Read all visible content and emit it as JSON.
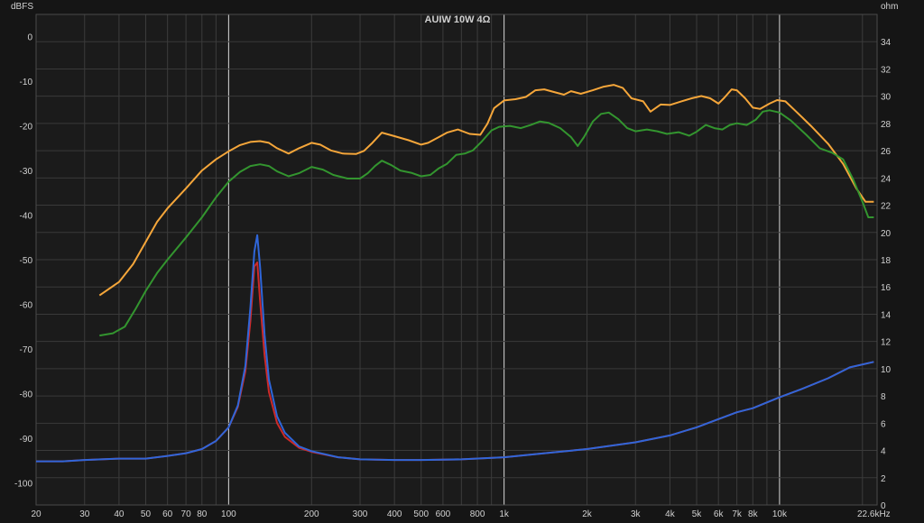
{
  "chart_data": {
    "type": "line",
    "title": "AUIW 10W 4Ω",
    "ylabel": "dBFS",
    "y2label": "ohm",
    "x_scale": "log",
    "xlim": [
      20,
      22600
    ],
    "ylim": [
      -105,
      5
    ],
    "y2lim": [
      0,
      36
    ],
    "grid": true,
    "x_ticks": [
      {
        "v": 20,
        "t": "20"
      },
      {
        "v": 30,
        "t": "30"
      },
      {
        "v": 40,
        "t": "40"
      },
      {
        "v": 50,
        "t": "50"
      },
      {
        "v": 60,
        "t": "60"
      },
      {
        "v": 70,
        "t": "70"
      },
      {
        "v": 80,
        "t": "80"
      },
      {
        "v": 100,
        "t": "100"
      },
      {
        "v": 200,
        "t": "200"
      },
      {
        "v": 300,
        "t": "300"
      },
      {
        "v": 400,
        "t": "400"
      },
      {
        "v": 500,
        "t": "500"
      },
      {
        "v": 600,
        "t": "600"
      },
      {
        "v": 800,
        "t": "800"
      },
      {
        "v": 1000,
        "t": "1k"
      },
      {
        "v": 2000,
        "t": "2k"
      },
      {
        "v": 3000,
        "t": "3k"
      },
      {
        "v": 4000,
        "t": "4k"
      },
      {
        "v": 5000,
        "t": "5k"
      },
      {
        "v": 6000,
        "t": "6k"
      },
      {
        "v": 7000,
        "t": "7k"
      },
      {
        "v": 8000,
        "t": "8k"
      },
      {
        "v": 10000,
        "t": "10k"
      },
      {
        "v": 22600,
        "t": "22.6kHz"
      }
    ],
    "y_ticks": [
      "0",
      "-10",
      "-20",
      "-30",
      "-40",
      "-50",
      "-60",
      "-70",
      "-80",
      "-90",
      "-100"
    ],
    "y2_ticks": [
      "0",
      "2",
      "4",
      "6",
      "8",
      "10",
      "12",
      "14",
      "16",
      "18",
      "20",
      "22",
      "24",
      "26",
      "28",
      "30",
      "32",
      "34"
    ],
    "series": [
      {
        "axis": "left",
        "color": "#f5a63a",
        "points": [
          [
            34,
            -58
          ],
          [
            40,
            -55
          ],
          [
            45,
            -51
          ],
          [
            50,
            -46
          ],
          [
            55,
            -41.5
          ],
          [
            60,
            -38.5
          ],
          [
            70,
            -34
          ],
          [
            80,
            -30
          ],
          [
            90,
            -27.5
          ],
          [
            100,
            -25.7
          ],
          [
            110,
            -24.3
          ],
          [
            120,
            -23.6
          ],
          [
            130,
            -23.4
          ],
          [
            140,
            -23.8
          ],
          [
            150,
            -25
          ],
          [
            165,
            -26.2
          ],
          [
            180,
            -25
          ],
          [
            200,
            -23.8
          ],
          [
            215,
            -24.2
          ],
          [
            235,
            -25.5
          ],
          [
            260,
            -26.2
          ],
          [
            290,
            -26.3
          ],
          [
            310,
            -25.6
          ],
          [
            330,
            -24
          ],
          [
            360,
            -21.5
          ],
          [
            400,
            -22.3
          ],
          [
            450,
            -23.2
          ],
          [
            500,
            -24.2
          ],
          [
            530,
            -23.8
          ],
          [
            580,
            -22.5
          ],
          [
            620,
            -21.5
          ],
          [
            680,
            -20.8
          ],
          [
            750,
            -21.8
          ],
          [
            820,
            -22
          ],
          [
            870,
            -19.5
          ],
          [
            920,
            -16
          ],
          [
            1000,
            -14.3
          ],
          [
            1100,
            -14
          ],
          [
            1200,
            -13.5
          ],
          [
            1300,
            -12
          ],
          [
            1400,
            -11.8
          ],
          [
            1500,
            -12.3
          ],
          [
            1650,
            -13
          ],
          [
            1750,
            -12.2
          ],
          [
            1900,
            -12.8
          ],
          [
            2100,
            -12
          ],
          [
            2300,
            -11.2
          ],
          [
            2500,
            -10.8
          ],
          [
            2700,
            -11.5
          ],
          [
            2900,
            -13.8
          ],
          [
            3200,
            -14.5
          ],
          [
            3400,
            -16.8
          ],
          [
            3700,
            -15.2
          ],
          [
            4000,
            -15.3
          ],
          [
            4400,
            -14.5
          ],
          [
            4800,
            -13.8
          ],
          [
            5200,
            -13.3
          ],
          [
            5600,
            -13.8
          ],
          [
            6000,
            -15
          ],
          [
            6300,
            -13.7
          ],
          [
            6700,
            -11.8
          ],
          [
            7000,
            -12
          ],
          [
            7500,
            -13.8
          ],
          [
            8000,
            -15.9
          ],
          [
            8500,
            -16.2
          ],
          [
            9200,
            -15
          ],
          [
            9800,
            -14.2
          ],
          [
            10500,
            -14.5
          ],
          [
            11500,
            -16.8
          ],
          [
            13000,
            -20
          ],
          [
            15000,
            -24
          ],
          [
            17000,
            -28.5
          ],
          [
            19000,
            -34
          ],
          [
            20500,
            -37
          ],
          [
            22000,
            -37
          ]
        ]
      },
      {
        "axis": "left",
        "color": "#33952f",
        "points": [
          [
            34,
            -67
          ],
          [
            38,
            -66.5
          ],
          [
            42,
            -65
          ],
          [
            46,
            -61
          ],
          [
            50,
            -57
          ],
          [
            55,
            -53
          ],
          [
            60,
            -50
          ],
          [
            70,
            -45
          ],
          [
            80,
            -40.5
          ],
          [
            90,
            -36
          ],
          [
            100,
            -32.5
          ],
          [
            110,
            -30.3
          ],
          [
            120,
            -29
          ],
          [
            130,
            -28.6
          ],
          [
            140,
            -29
          ],
          [
            150,
            -30.2
          ],
          [
            165,
            -31.3
          ],
          [
            180,
            -30.6
          ],
          [
            200,
            -29.2
          ],
          [
            220,
            -29.8
          ],
          [
            240,
            -31
          ],
          [
            270,
            -31.8
          ],
          [
            300,
            -31.8
          ],
          [
            320,
            -30.6
          ],
          [
            340,
            -29
          ],
          [
            360,
            -27.8
          ],
          [
            390,
            -28.8
          ],
          [
            420,
            -30
          ],
          [
            460,
            -30.5
          ],
          [
            500,
            -31.3
          ],
          [
            540,
            -31
          ],
          [
            580,
            -29.5
          ],
          [
            620,
            -28.5
          ],
          [
            670,
            -26.5
          ],
          [
            720,
            -26.2
          ],
          [
            770,
            -25.5
          ],
          [
            830,
            -23.5
          ],
          [
            900,
            -21
          ],
          [
            960,
            -20.2
          ],
          [
            1050,
            -20
          ],
          [
            1150,
            -20.5
          ],
          [
            1250,
            -19.8
          ],
          [
            1350,
            -19
          ],
          [
            1450,
            -19.3
          ],
          [
            1600,
            -20.5
          ],
          [
            1750,
            -22.5
          ],
          [
            1850,
            -24.5
          ],
          [
            1950,
            -22.5
          ],
          [
            2100,
            -19
          ],
          [
            2250,
            -17.3
          ],
          [
            2400,
            -17
          ],
          [
            2600,
            -18.5
          ],
          [
            2800,
            -20.5
          ],
          [
            3000,
            -21.2
          ],
          [
            3300,
            -20.8
          ],
          [
            3600,
            -21.2
          ],
          [
            3900,
            -21.8
          ],
          [
            4300,
            -21.4
          ],
          [
            4700,
            -22.2
          ],
          [
            5000,
            -21.3
          ],
          [
            5400,
            -19.8
          ],
          [
            5800,
            -20.5
          ],
          [
            6200,
            -20.8
          ],
          [
            6600,
            -19.8
          ],
          [
            7000,
            -19.4
          ],
          [
            7600,
            -19.8
          ],
          [
            8200,
            -18.6
          ],
          [
            8700,
            -16.8
          ],
          [
            9200,
            -16.5
          ],
          [
            10000,
            -17
          ],
          [
            11000,
            -18.8
          ],
          [
            12500,
            -22
          ],
          [
            14000,
            -25
          ],
          [
            15500,
            -26
          ],
          [
            17000,
            -27.5
          ],
          [
            18500,
            -32
          ],
          [
            20000,
            -37
          ],
          [
            21000,
            -40.5
          ],
          [
            22000,
            -40.5
          ]
        ]
      },
      {
        "axis": "right",
        "color": "#cc2a2a",
        "points": [
          [
            20,
            3.2
          ],
          [
            25,
            3.2
          ],
          [
            30,
            3.3
          ],
          [
            40,
            3.4
          ],
          [
            50,
            3.4
          ],
          [
            60,
            3.6
          ],
          [
            70,
            3.8
          ],
          [
            80,
            4.1
          ],
          [
            90,
            4.7
          ],
          [
            100,
            5.7
          ],
          [
            108,
            7.2
          ],
          [
            115,
            9.8
          ],
          [
            120,
            13.5
          ],
          [
            124,
            17.5
          ],
          [
            127,
            17.8
          ],
          [
            130,
            15
          ],
          [
            135,
            11
          ],
          [
            140,
            8.3
          ],
          [
            150,
            6
          ],
          [
            160,
            5
          ],
          [
            180,
            4.2
          ],
          [
            200,
            3.9
          ],
          [
            250,
            3.5
          ],
          [
            300,
            3.35
          ],
          [
            400,
            3.3
          ],
          [
            500,
            3.3
          ],
          [
            700,
            3.35
          ],
          [
            1000,
            3.5
          ],
          [
            1500,
            3.85
          ],
          [
            2000,
            4.1
          ],
          [
            3000,
            4.6
          ],
          [
            4000,
            5.1
          ],
          [
            5000,
            5.7
          ],
          [
            6000,
            6.3
          ],
          [
            7000,
            6.8
          ],
          [
            8000,
            7.1
          ],
          [
            10000,
            7.9
          ],
          [
            12000,
            8.5
          ],
          [
            15000,
            9.3
          ],
          [
            18000,
            10.1
          ],
          [
            22000,
            10.5
          ]
        ]
      },
      {
        "axis": "right",
        "color": "#2f66d9",
        "points": [
          [
            20,
            3.2
          ],
          [
            25,
            3.2
          ],
          [
            30,
            3.3
          ],
          [
            40,
            3.4
          ],
          [
            50,
            3.4
          ],
          [
            60,
            3.6
          ],
          [
            70,
            3.8
          ],
          [
            80,
            4.1
          ],
          [
            90,
            4.7
          ],
          [
            100,
            5.7
          ],
          [
            108,
            7.3
          ],
          [
            115,
            10.2
          ],
          [
            120,
            14.5
          ],
          [
            124,
            18.6
          ],
          [
            127,
            19.8
          ],
          [
            130,
            17.5
          ],
          [
            135,
            12.5
          ],
          [
            140,
            9.2
          ],
          [
            150,
            6.5
          ],
          [
            160,
            5.3
          ],
          [
            180,
            4.3
          ],
          [
            200,
            3.95
          ],
          [
            250,
            3.5
          ],
          [
            300,
            3.35
          ],
          [
            400,
            3.3
          ],
          [
            500,
            3.3
          ],
          [
            700,
            3.35
          ],
          [
            1000,
            3.5
          ],
          [
            1500,
            3.85
          ],
          [
            2000,
            4.1
          ],
          [
            3000,
            4.6
          ],
          [
            4000,
            5.1
          ],
          [
            5000,
            5.7
          ],
          [
            6000,
            6.3
          ],
          [
            7000,
            6.8
          ],
          [
            8000,
            7.1
          ],
          [
            10000,
            7.9
          ],
          [
            12000,
            8.5
          ],
          [
            15000,
            9.3
          ],
          [
            18000,
            10.1
          ],
          [
            22000,
            10.5
          ]
        ]
      }
    ]
  }
}
